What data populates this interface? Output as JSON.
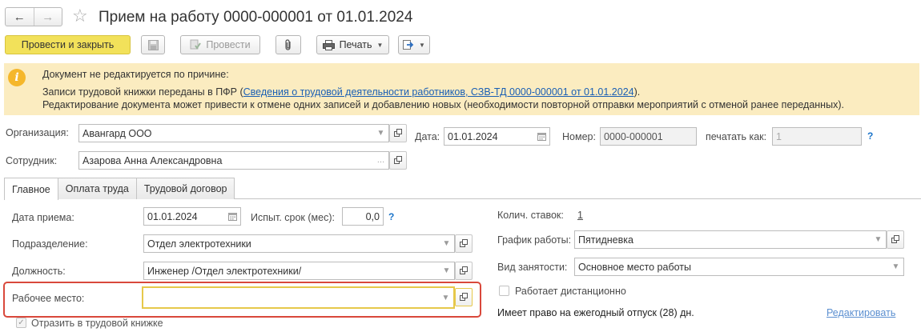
{
  "header": {
    "back_glyph": "←",
    "forward_glyph": "→",
    "star_glyph": "☆",
    "title": "Прием на работу 0000-000001 от 01.01.2024"
  },
  "toolbar": {
    "post_close_label": "Провести и закрыть",
    "post_label": "Провести",
    "print_label": "Печать"
  },
  "info": {
    "line1": "Документ не редактируется по причине:",
    "line2_prefix": "Записи трудовой книжки переданы в ПФР (",
    "line2_link": "Сведения о трудовой деятельности работников, СЗВ-ТД 0000-000001 от 01.01.2024",
    "line2_suffix": ").",
    "line3": "Редактирование документа может привести к отмене одних записей и добавлению новых (необходимости повторной отправки мероприятий с отменой ранее переданных)."
  },
  "form": {
    "org_label": "Организация:",
    "org_value": "Авангард ООО",
    "date_label": "Дата:",
    "date_value": "01.01.2024",
    "number_label": "Номер:",
    "number_value": "0000-000001",
    "print_as_label": "печатать как:",
    "print_as_value": "1",
    "employee_label": "Сотрудник:",
    "employee_value": "Азарова Анна Александровна"
  },
  "tabs": [
    "Главное",
    "Оплата труда",
    "Трудовой договор"
  ],
  "main": {
    "hire_date_label": "Дата приема:",
    "hire_date_value": "01.01.2024",
    "probation_label": "Испыт. срок (мес):",
    "probation_value": "0,0",
    "division_label": "Подразделение:",
    "division_value": "Отдел электротехники",
    "position_label": "Должность:",
    "position_value": "Инженер /Отдел электротехники/",
    "workplace_label": "Рабочее место:",
    "workplace_value": "",
    "reflect_label": "Отразить в трудовой книжке",
    "rates_label": "Колич. ставок:",
    "rates_value": "1",
    "schedule_label": "График работы:",
    "schedule_value": "Пятидневка",
    "employment_label": "Вид занятости:",
    "employment_value": "Основное место работы",
    "remote_label": "Работает дистанционно",
    "vacation_text": "Имеет право на ежегодный отпуск (28) дн.",
    "edit_link": "Редактировать",
    "help_glyph": "?"
  },
  "colors": {
    "primary_button": "#f2e15a",
    "info_background": "#fbecc0",
    "info_icon": "#f5b72b",
    "link": "#1a5fb4",
    "highlight_border": "#d9483b",
    "focus_border": "#e6c84a"
  }
}
